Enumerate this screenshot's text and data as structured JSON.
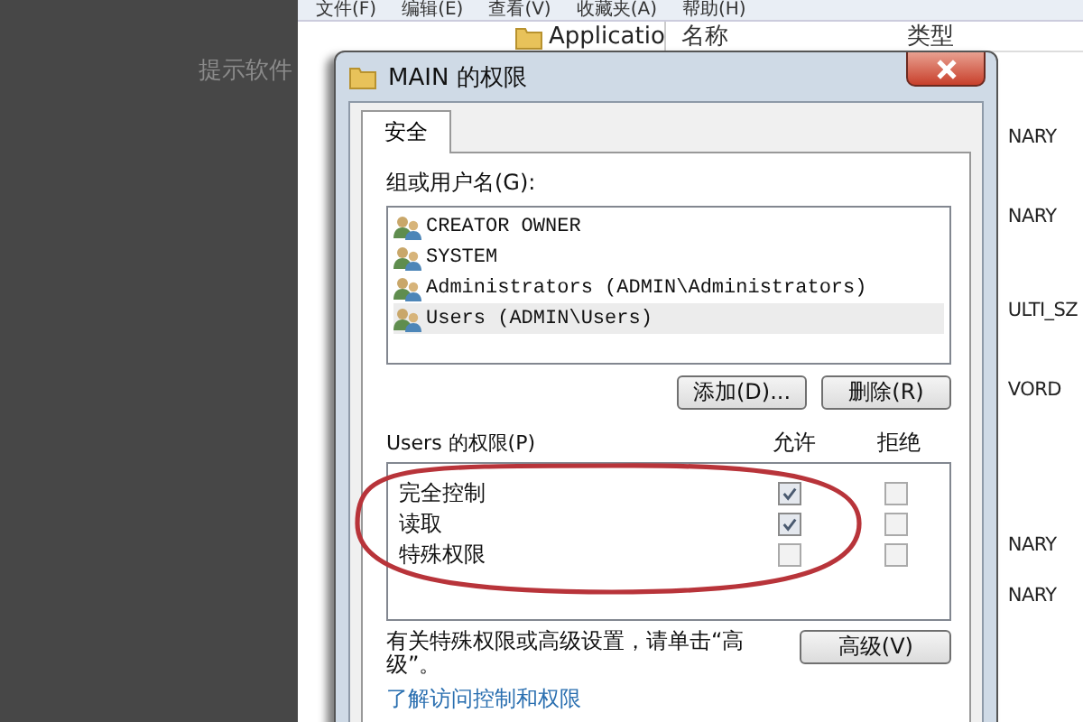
{
  "side_pane": {
    "text": "提示软件"
  },
  "explorer": {
    "menu": [
      "文件(F)",
      "编辑(E)",
      "查看(V)",
      "收藏夹(A)",
      "帮助(H)"
    ],
    "tree_item": "Applicatio",
    "columns": [
      "名称",
      "类型"
    ],
    "type_values": [
      "NARY",
      "NARY",
      "ULTI_SZ",
      "VORD",
      "NARY",
      "NARY"
    ]
  },
  "dialog": {
    "title": "MAIN 的权限",
    "tabs": [
      {
        "label": "安全",
        "selected": true
      }
    ],
    "group_label": "组或用户名(G):",
    "principals": [
      {
        "name": "CREATOR OWNER",
        "selected": false
      },
      {
        "name": "SYSTEM",
        "selected": false
      },
      {
        "name": "Administrators (ADMIN\\Administrators)",
        "selected": false
      },
      {
        "name": "Users (ADMIN\\Users)",
        "selected": true
      }
    ],
    "buttons": [
      "添加(D)...",
      "删除(R)"
    ],
    "permissions_label": "Users 的权限(P)",
    "permission_columns": [
      "允许",
      "拒绝"
    ],
    "permissions": [
      {
        "name": "完全控制",
        "allow": true,
        "deny": false
      },
      {
        "name": "读取",
        "allow": true,
        "deny": false
      },
      {
        "name": "特殊权限",
        "allow": false,
        "deny": false
      }
    ],
    "info_text": "有关特殊权限或高级设置，请单击“高级”。",
    "advanced_button": "高级(V)",
    "link": "了解访问控制和权限"
  }
}
